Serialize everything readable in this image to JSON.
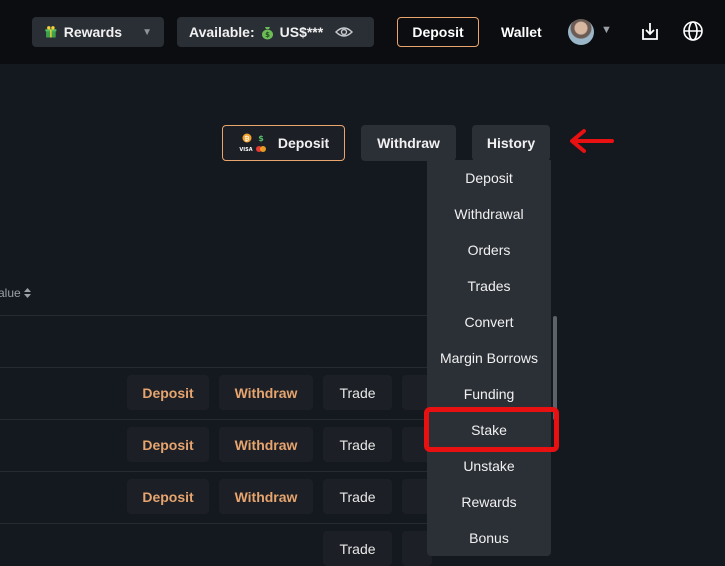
{
  "topbar": {
    "rewards_label": "Rewards",
    "available_label": "Available:",
    "available_value": "US$***",
    "deposit_label": "Deposit",
    "wallet_label": "Wallet"
  },
  "actions": {
    "deposit_label": "Deposit",
    "withdraw_label": "Withdraw",
    "history_label": "History"
  },
  "table": {
    "column_header": "alue",
    "rows": [
      {
        "deposit": "Deposit",
        "withdraw": "Withdraw",
        "trade": "Trade"
      },
      {
        "deposit": "Deposit",
        "withdraw": "Withdraw",
        "trade": "Trade"
      },
      {
        "deposit": "Deposit",
        "withdraw": "Withdraw",
        "trade": "Trade"
      },
      {
        "trade": "Trade"
      }
    ]
  },
  "history_menu": {
    "items": [
      "Deposit",
      "Withdrawal",
      "Orders",
      "Trades",
      "Convert",
      "Margin Borrows",
      "Funding",
      "Stake",
      "Unstake",
      "Rewards",
      "Bonus"
    ],
    "highlighted": "Stake"
  },
  "colors": {
    "accent": "#e9a56b",
    "highlight": "#e81010",
    "background": "#14181f",
    "menu_bg": "#2b2f36"
  },
  "icons": [
    "gift-icon",
    "chevron-down-icon",
    "money-bag-icon",
    "eye-icon",
    "avatar",
    "download-icon",
    "globe-icon",
    "crypto-card-icon",
    "arrow-left-icon",
    "sort-icon"
  ]
}
